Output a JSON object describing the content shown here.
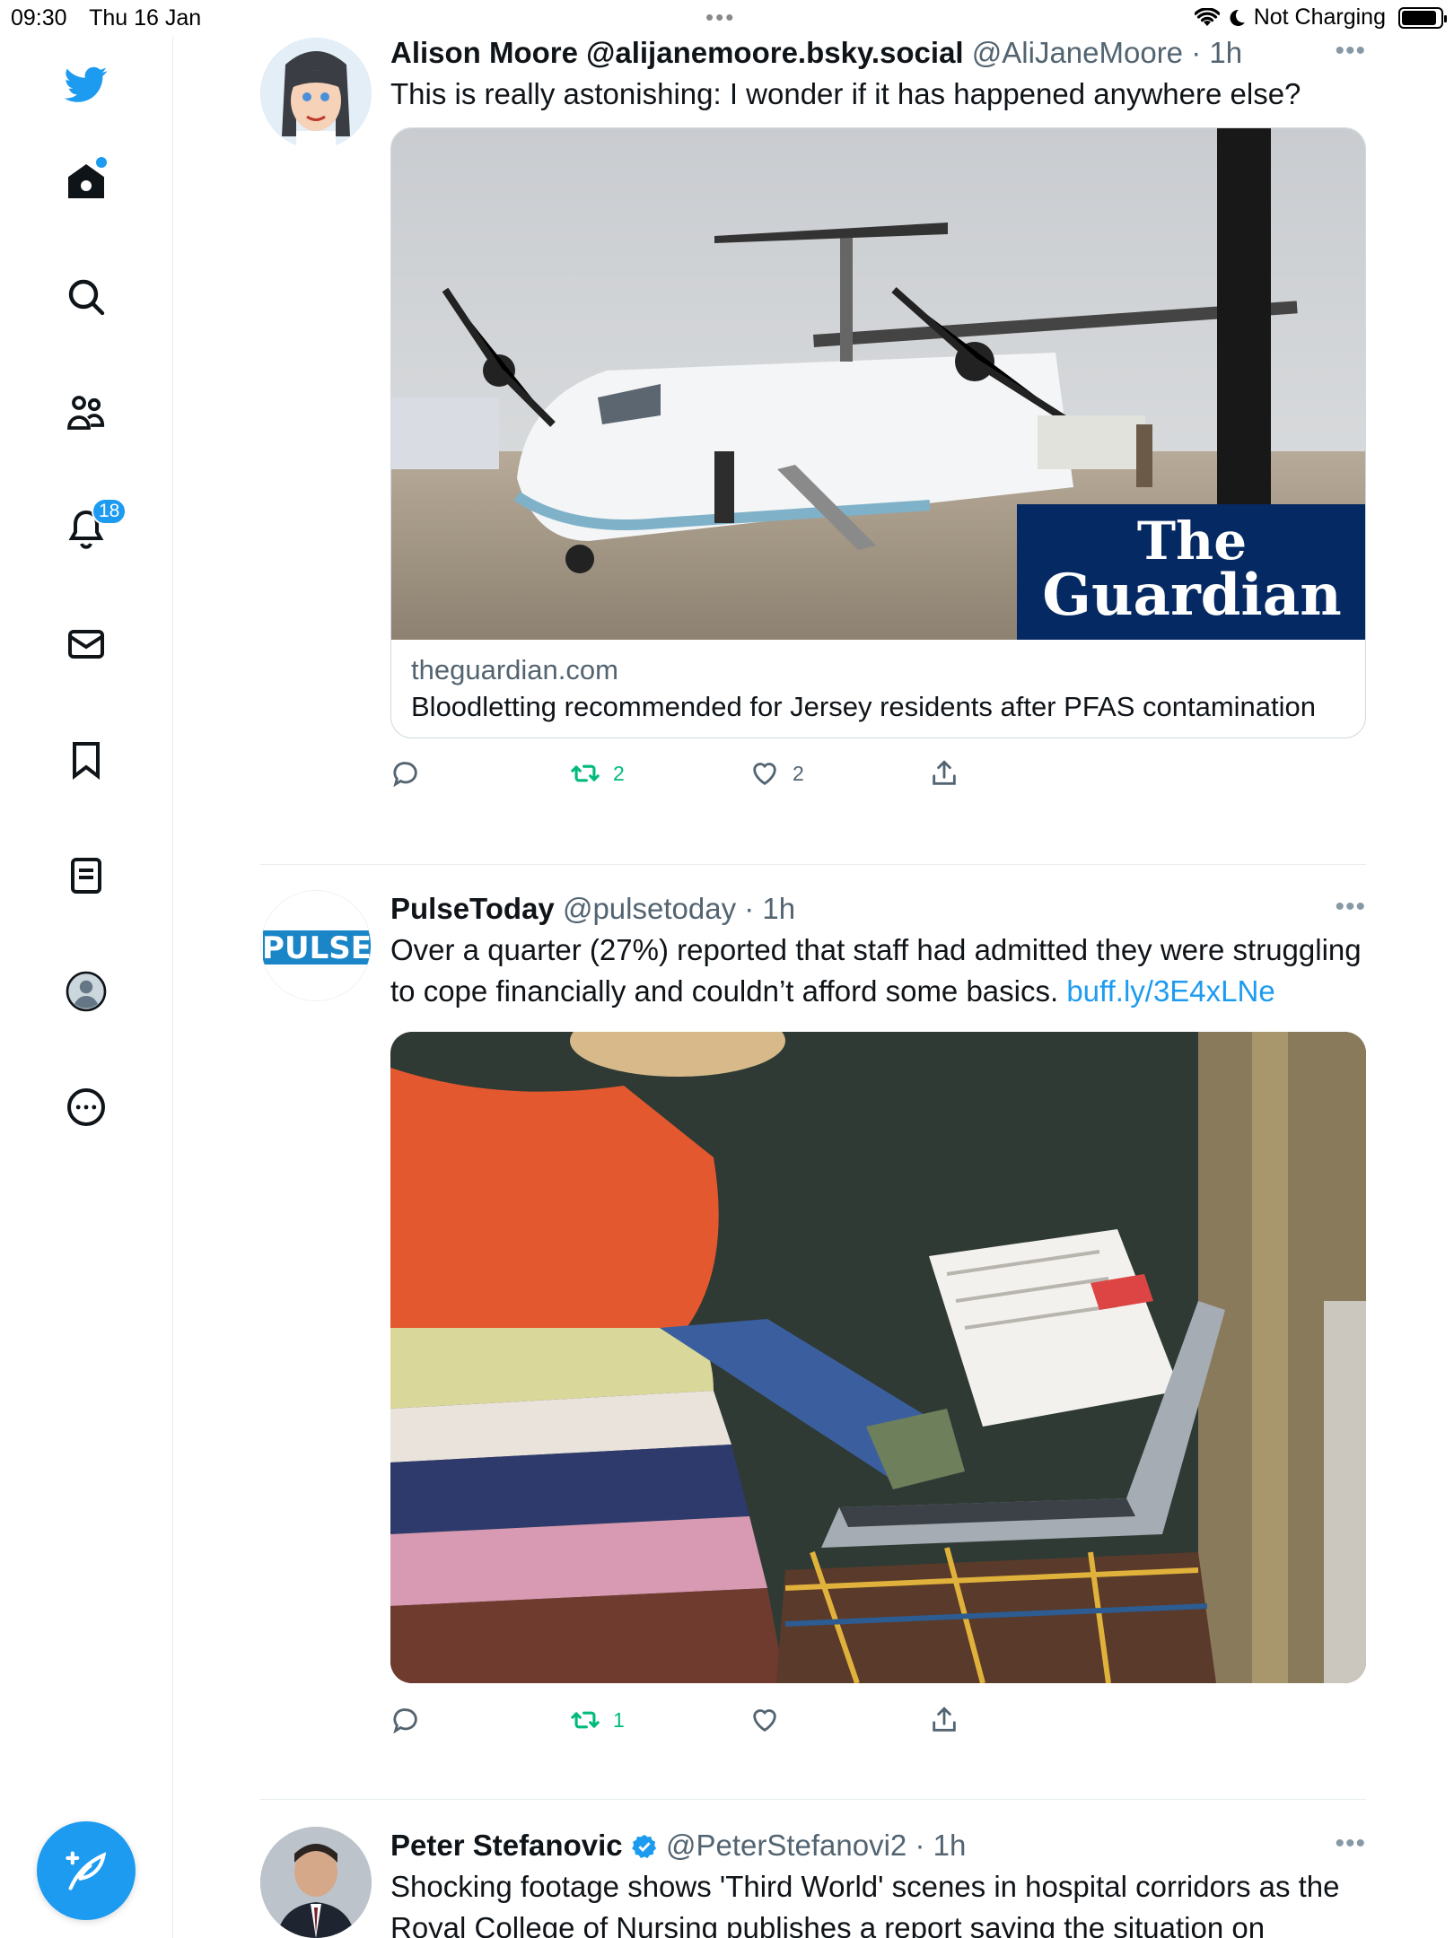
{
  "status_bar": {
    "time": "09:30",
    "date": "Thu 16 Jan",
    "dots": "•••",
    "battery_label": "Not Charging"
  },
  "sidebar": {
    "items": [
      {
        "name": "twitter-logo-icon"
      },
      {
        "name": "home-icon"
      },
      {
        "name": "search-icon"
      },
      {
        "name": "communities-icon"
      },
      {
        "name": "notifications-icon",
        "badge": "18"
      },
      {
        "name": "messages-icon"
      },
      {
        "name": "bookmarks-icon"
      },
      {
        "name": "lists-icon"
      },
      {
        "name": "profile-icon"
      },
      {
        "name": "more-icon"
      }
    ],
    "accent": "#1d9bf0"
  },
  "tweets": [
    {
      "name": "Alison Moore @alijanemoore.bsky.social",
      "handle": "@AliJaneMoore",
      "sep": " · ",
      "time": "1h",
      "text": "This is really astonishing: I wonder if it has happened anywhere else?",
      "card": {
        "brand_line1": "The",
        "brand_line2": "Guardian",
        "domain": "theguardian.com",
        "title": "Bloodletting recommended for Jersey residents after PFAS contamination"
      },
      "replies": "",
      "retweets": "2",
      "likes": "2"
    },
    {
      "name": "PulseToday",
      "handle": "@pulsetoday",
      "sep": " · ",
      "time": "1h",
      "avatar_text": "PULSE",
      "text": "Over a quarter (27%) reported that staff had admitted they were struggling to cope financially and couldn’t afford some basics. ",
      "link": "buff.ly/3E4xLNe",
      "replies": "",
      "retweets": "1",
      "likes": ""
    },
    {
      "name": "Peter Stefanovic",
      "handle": "@PeterStefanovi2",
      "sep": " · ",
      "time": "1h",
      "verified": true,
      "text": "Shocking footage shows 'Third World' scenes in hospital corridors as the Royal College of Nursing publishes a report saying the situation on"
    }
  ]
}
